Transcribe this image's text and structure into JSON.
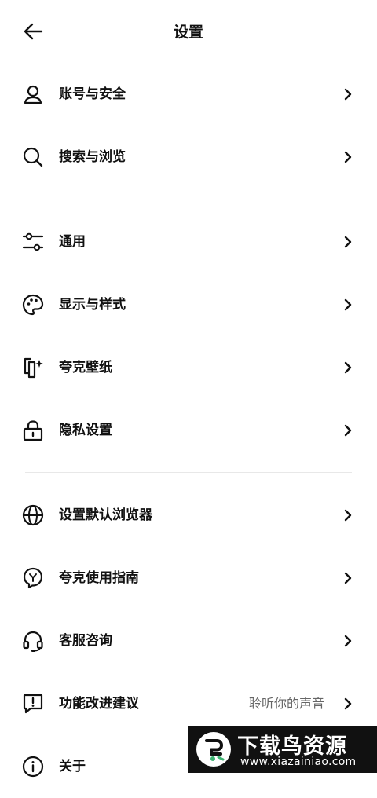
{
  "header": {
    "title": "设置",
    "back_icon": "arrow-left-icon"
  },
  "sections": [
    [
      {
        "label": "账号与安全",
        "icon": "user-icon"
      },
      {
        "label": "搜索与浏览",
        "icon": "search-icon"
      }
    ],
    [
      {
        "label": "通用",
        "icon": "sliders-icon"
      },
      {
        "label": "显示与样式",
        "icon": "palette-icon"
      },
      {
        "label": "夸克壁纸",
        "icon": "wallpaper-icon"
      },
      {
        "label": "隐私设置",
        "icon": "lock-icon"
      }
    ],
    [
      {
        "label": "设置默认浏览器",
        "icon": "globe-icon"
      },
      {
        "label": "夸克使用指南",
        "icon": "guide-icon"
      },
      {
        "label": "客服咨询",
        "icon": "headset-icon"
      },
      {
        "label": "功能改进建议",
        "icon": "feedback-icon",
        "value": "聆听你的声音"
      },
      {
        "label": "关于",
        "icon": "info-icon"
      }
    ]
  ],
  "watermark": {
    "title": "下载鸟资源",
    "url": "www.xiazainiao.com"
  }
}
